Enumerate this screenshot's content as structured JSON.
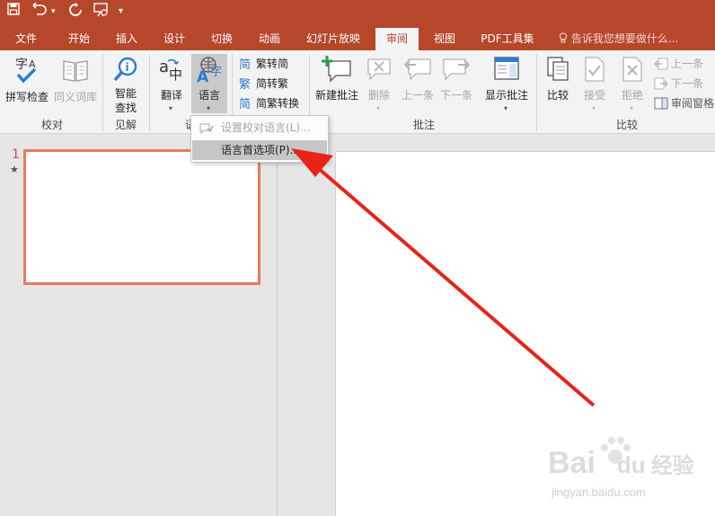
{
  "quick_access": {
    "save": "save-icon",
    "undo": "undo-icon",
    "redo": "redo-icon",
    "present": "present-icon",
    "customize": "▾"
  },
  "tabs": [
    {
      "label": "文件"
    },
    {
      "label": "开始"
    },
    {
      "label": "插入"
    },
    {
      "label": "设计"
    },
    {
      "label": "切换"
    },
    {
      "label": "动画"
    },
    {
      "label": "幻灯片放映"
    },
    {
      "label": "审阅",
      "active": true
    },
    {
      "label": "视图"
    },
    {
      "label": "PDF工具集"
    }
  ],
  "tell_me": "告诉我您想要做什么...",
  "ribbon": {
    "spell_check": "拼写检查",
    "thesaurus": "同义词库",
    "smart_lookup_l1": "智能",
    "smart_lookup_l2": "查找",
    "translate": "翻译",
    "language": "语言",
    "trad_to_simp": "繁转简",
    "simp_to_trad": "简转繁",
    "convert": "简繁转换",
    "new_comment": "新建批注",
    "delete": "删除",
    "previous": "上一条",
    "next": "下一条",
    "show_comments": "显示批注",
    "compare": "比较",
    "accept": "接受",
    "reject": "拒绝",
    "prev_change": "上一条",
    "next_change": "下一条",
    "reviewing_pane": "审阅窗格",
    "groups": {
      "proofing": "校对",
      "insights": "见解",
      "language": "语",
      "comments": "批注",
      "compare": "比较"
    }
  },
  "language_menu": {
    "set_proofing": "设置校对语言(L)...",
    "language_prefs": "语言首选项(P)..."
  },
  "slide_panel": {
    "slide_number": "1",
    "animation_marker": "★"
  },
  "watermark": {
    "brand_bai": "Bai",
    "brand_du": "du",
    "brand_cn": "经验",
    "url": "jingyan.baidu.com"
  },
  "colors": {
    "accent": "#b7472a",
    "annotation_arrow": "#e8231a"
  }
}
